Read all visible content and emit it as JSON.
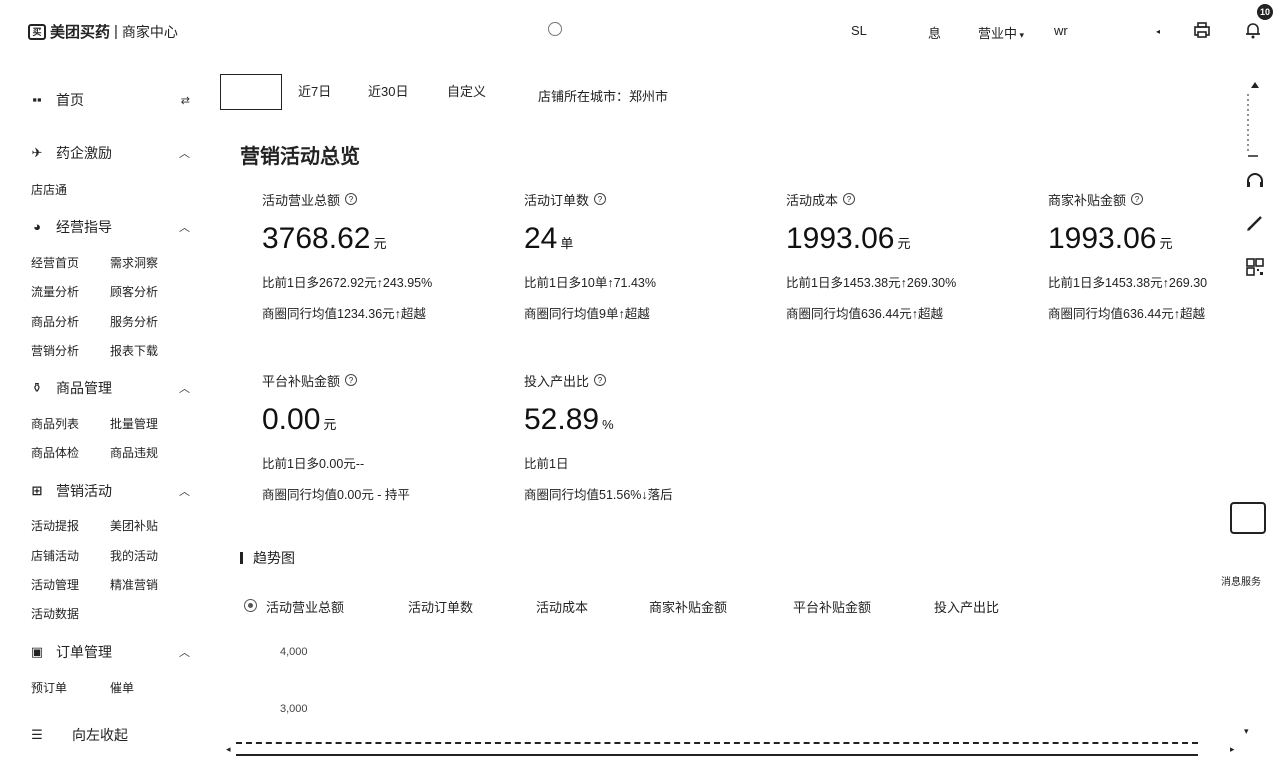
{
  "header": {
    "brand": "美团买药",
    "separator": "|",
    "center": "商家中心",
    "search_placeholder": "",
    "item_1": "SL",
    "item_2": "息",
    "status": "营业中",
    "user": "wr"
  },
  "sidebar": {
    "home": "首页",
    "pharma": "药企激励",
    "pharma_sub": [
      "店店通"
    ],
    "guide": "经营指导",
    "guide_sub": [
      "经营首页",
      "需求洞察",
      "流量分析",
      "顾客分析",
      "商品分析",
      "服务分析",
      "营销分析",
      "报表下载"
    ],
    "goods": "商品管理",
    "goods_sub": [
      "商品列表",
      "批量管理",
      "商品体检",
      "商品违规"
    ],
    "marketing": "营销活动",
    "marketing_sub": [
      "活动提报",
      "美团补贴",
      "店铺活动",
      "我的活动",
      "活动管理",
      "精准营销",
      "活动数据"
    ],
    "orders": "订单管理",
    "orders_sub": [
      "预订单",
      "催单"
    ],
    "collapse": "向左收起"
  },
  "filters": {
    "active": "",
    "d7": "近7日",
    "d30": "近30日",
    "custom": "自定义",
    "city": "店铺所在城市：郑州市"
  },
  "title": "营销活动总览",
  "cards": [
    {
      "label": "活动营业总额",
      "value": "3768.62",
      "unit": "元",
      "cmp": "比前1日多2672.92元↑243.95%",
      "avg": "商圈同行均值1234.36元↑超越"
    },
    {
      "label": "活动订单数",
      "value": "24",
      "unit": "单",
      "cmp": "比前1日多10单↑71.43%",
      "avg": "商圈同行均值9单↑超越"
    },
    {
      "label": "活动成本",
      "value": "1993.06",
      "unit": "元",
      "cmp": "比前1日多1453.38元↑269.30%",
      "avg": "商圈同行均值636.44元↑超越"
    },
    {
      "label": "商家补贴金额",
      "value": "1993.06",
      "unit": "元",
      "cmp": "比前1日多1453.38元↑269.30",
      "avg": "商圈同行均值636.44元↑超越"
    },
    {
      "label": "平台补贴金额",
      "value": "0.00",
      "unit": "元",
      "cmp": "比前1日多0.00元--",
      "avg": "商圈同行均值0.00元 - 持平"
    },
    {
      "label": "投入产出比",
      "value": "52.89",
      "unit": "%",
      "cmp": "比前1日",
      "avg": "商圈同行均值51.56%↓落后"
    }
  ],
  "trend": {
    "title": "趋势图",
    "tabs": [
      "活动营业总额",
      "活动订单数",
      "活动成本",
      "商家补贴金额",
      "平台补贴金额",
      "投入产出比"
    ],
    "yticks": [
      "4,000",
      "3,000"
    ]
  },
  "badge": "10",
  "float_label": "消息服务",
  "float_value": ""
}
